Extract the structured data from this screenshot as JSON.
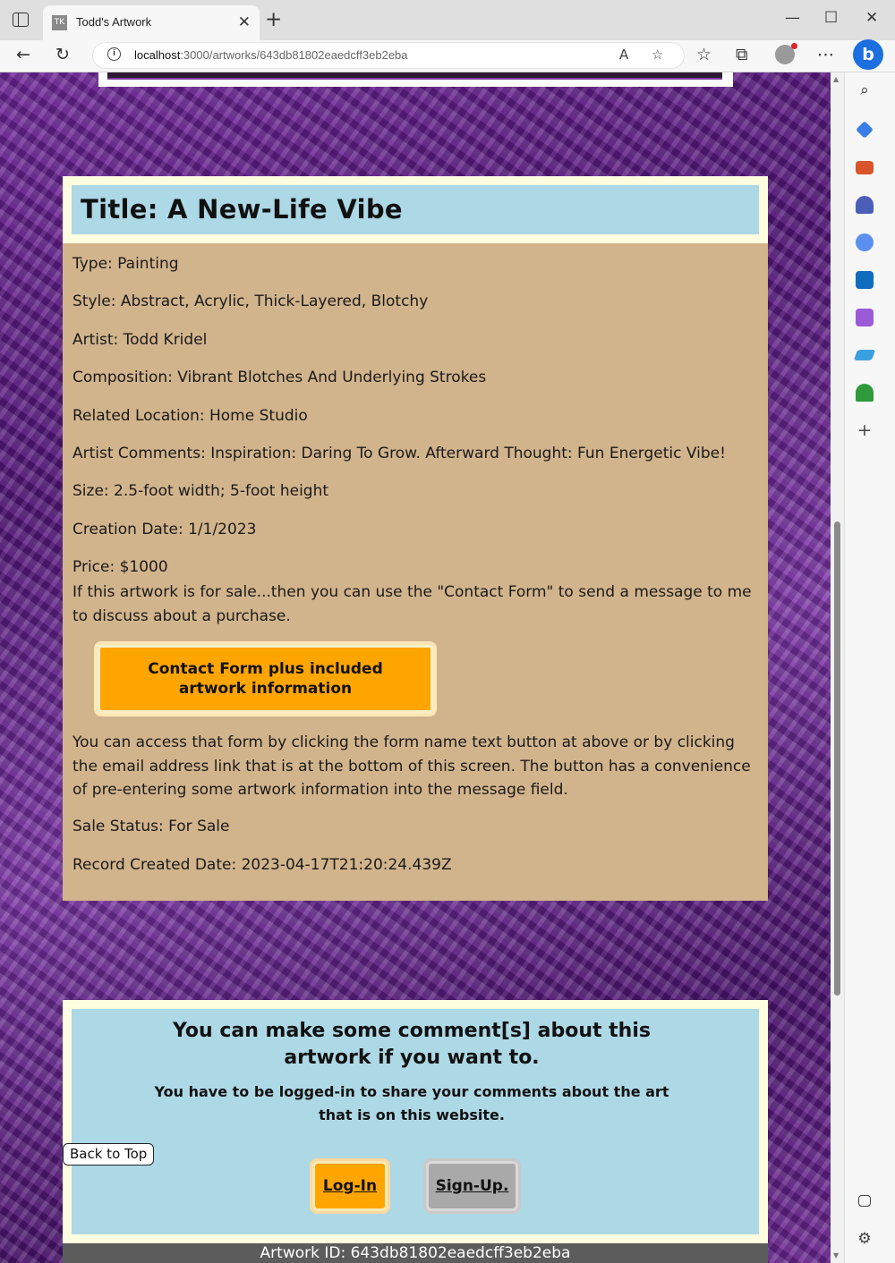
{
  "browser": {
    "tab_title": "Todd's Artwork",
    "tab_favicon": "TK",
    "url_host": "localhost",
    "url_path": ":3000/artworks/643db81802eaedcff3eb2eba",
    "minimize": "—",
    "maximize": "☐",
    "close": "✕",
    "new_tab": "+"
  },
  "artwork": {
    "title": "Title: A New-Life Vibe",
    "type": "Type: Painting",
    "style": "Style: Abstract, Acrylic, Thick-Layered, Blotchy",
    "artist": "Artist: Todd Kridel",
    "composition": "Composition: Vibrant Blotches And Underlying Strokes",
    "related_location": "Related Location: Home Studio",
    "artist_comments": "Artist Comments: Inspiration: Daring To Grow. Afterward Thought: Fun Energetic Vibe!",
    "size": "Size: 2.5-foot width; 5-foot height",
    "creation_date": "Creation Date: 1/1/2023",
    "price": "Price: $1000",
    "sale_note": "If this artwork is for sale...then you can use the \"Contact Form\" to send a message to me to discuss about a purchase.",
    "contact_button": "Contact Form plus included artwork information",
    "form_note": "You can access that form by clicking the form name text button at above or by clicking the email address link that is at the bottom of this screen. The button has a convenience of pre-entering some artwork information into the message field.",
    "sale_status": "Sale Status: For Sale",
    "record_created": "Record Created Date: 2023-04-17T21:20:24.439Z"
  },
  "comments": {
    "heading": "You can make some comment[s] about this artwork if you want to.",
    "subheading": "You have to be logged-in to share your comments about the art that is on this website.",
    "login_label": "Log-In",
    "signup_label": "Sign-Up."
  },
  "back_to_top": "Back to Top",
  "footer": {
    "artwork_id": "Artwork ID: 643db81802eaedcff3eb2eba"
  },
  "colors": {
    "card_bg": "#d2b48c",
    "header_bg": "#add8e6",
    "frame_bg": "#fdfde0",
    "accent_button": "#ffa500",
    "disabled_button": "#a9a9a9"
  },
  "sidebar_icons": [
    "search-icon",
    "tag-icon",
    "briefcase-icon",
    "chess-icon",
    "copilot-circle-icon",
    "outlook-icon",
    "designer-icon",
    "send-icon",
    "tree-icon",
    "add-icon"
  ]
}
